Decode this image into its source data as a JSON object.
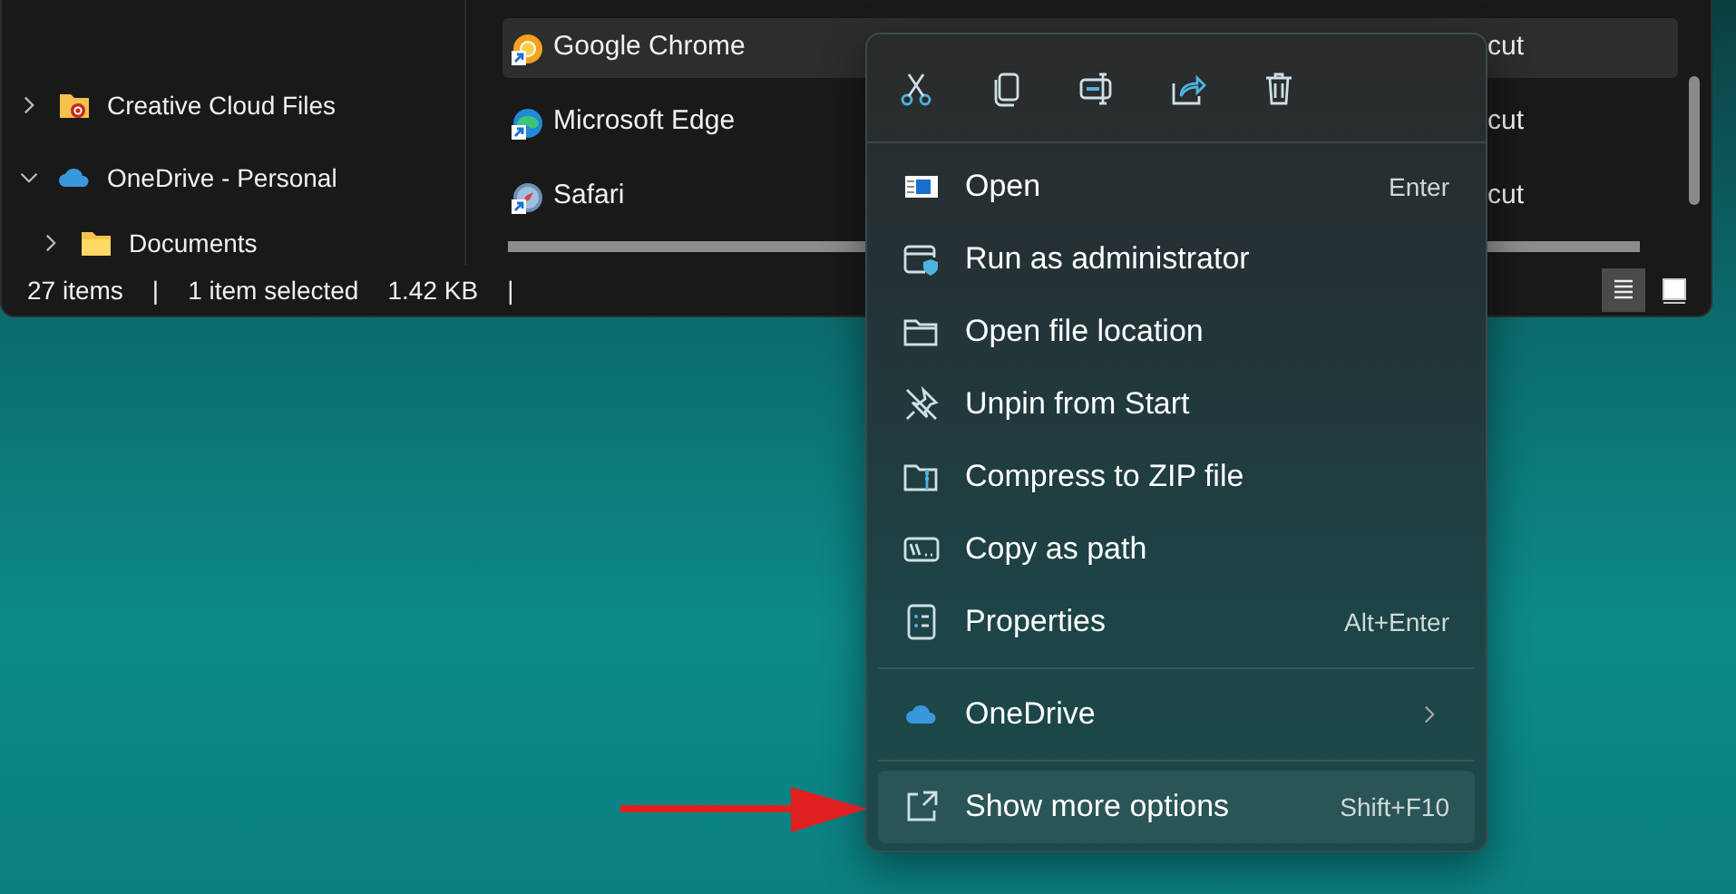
{
  "explorer": {
    "nav_items": [
      {
        "label": "Creative Cloud Files",
        "kind": "cc-folder",
        "expanded": false
      },
      {
        "label": "OneDrive - Personal",
        "kind": "cloud",
        "expanded": true,
        "children": [
          {
            "label": "Documents",
            "kind": "folder",
            "expanded": false
          }
        ]
      }
    ],
    "files": [
      {
        "name": "Google Chrome",
        "type": "cut",
        "kind": "chrome",
        "selected": true
      },
      {
        "name": "Microsoft Edge",
        "type": "cut",
        "kind": "edge",
        "selected": false
      },
      {
        "name": "Safari",
        "type": "cut",
        "kind": "safari",
        "selected": false
      }
    ],
    "status_bar": [
      "27 items",
      "|",
      "1 item selected",
      "1.42 KB",
      "|"
    ],
    "view_buttons": [
      {
        "kind": "details",
        "selected": true
      },
      {
        "kind": "tiles",
        "selected": false
      }
    ]
  },
  "context_menu": {
    "actions": [
      {
        "kind": "cut"
      },
      {
        "kind": "copy"
      },
      {
        "kind": "rename"
      },
      {
        "kind": "share"
      },
      {
        "kind": "delete"
      }
    ],
    "items": [
      {
        "label": "Open",
        "shortcut": "Enter",
        "kind": "open",
        "highlighted": false
      },
      {
        "label": "Run as administrator",
        "kind": "admin",
        "highlighted": false
      },
      {
        "label": "Open file location",
        "kind": "location",
        "highlighted": false
      },
      {
        "label": "Unpin from Start",
        "kind": "unpin",
        "highlighted": false
      },
      {
        "label": "Compress to ZIP file",
        "kind": "zip",
        "highlighted": false
      },
      {
        "label": "Copy as path",
        "kind": "path",
        "highlighted": false
      },
      {
        "label": "Properties",
        "shortcut": "Alt+Enter",
        "kind": "properties",
        "highlighted": false
      },
      {
        "label": "OneDrive",
        "kind": "onedrive",
        "submenu": true,
        "separator_before": true,
        "highlighted": false
      },
      {
        "label": "Show more options",
        "shortcut": "Shift+F10",
        "kind": "more",
        "separator_before": true,
        "highlighted": true
      }
    ]
  }
}
